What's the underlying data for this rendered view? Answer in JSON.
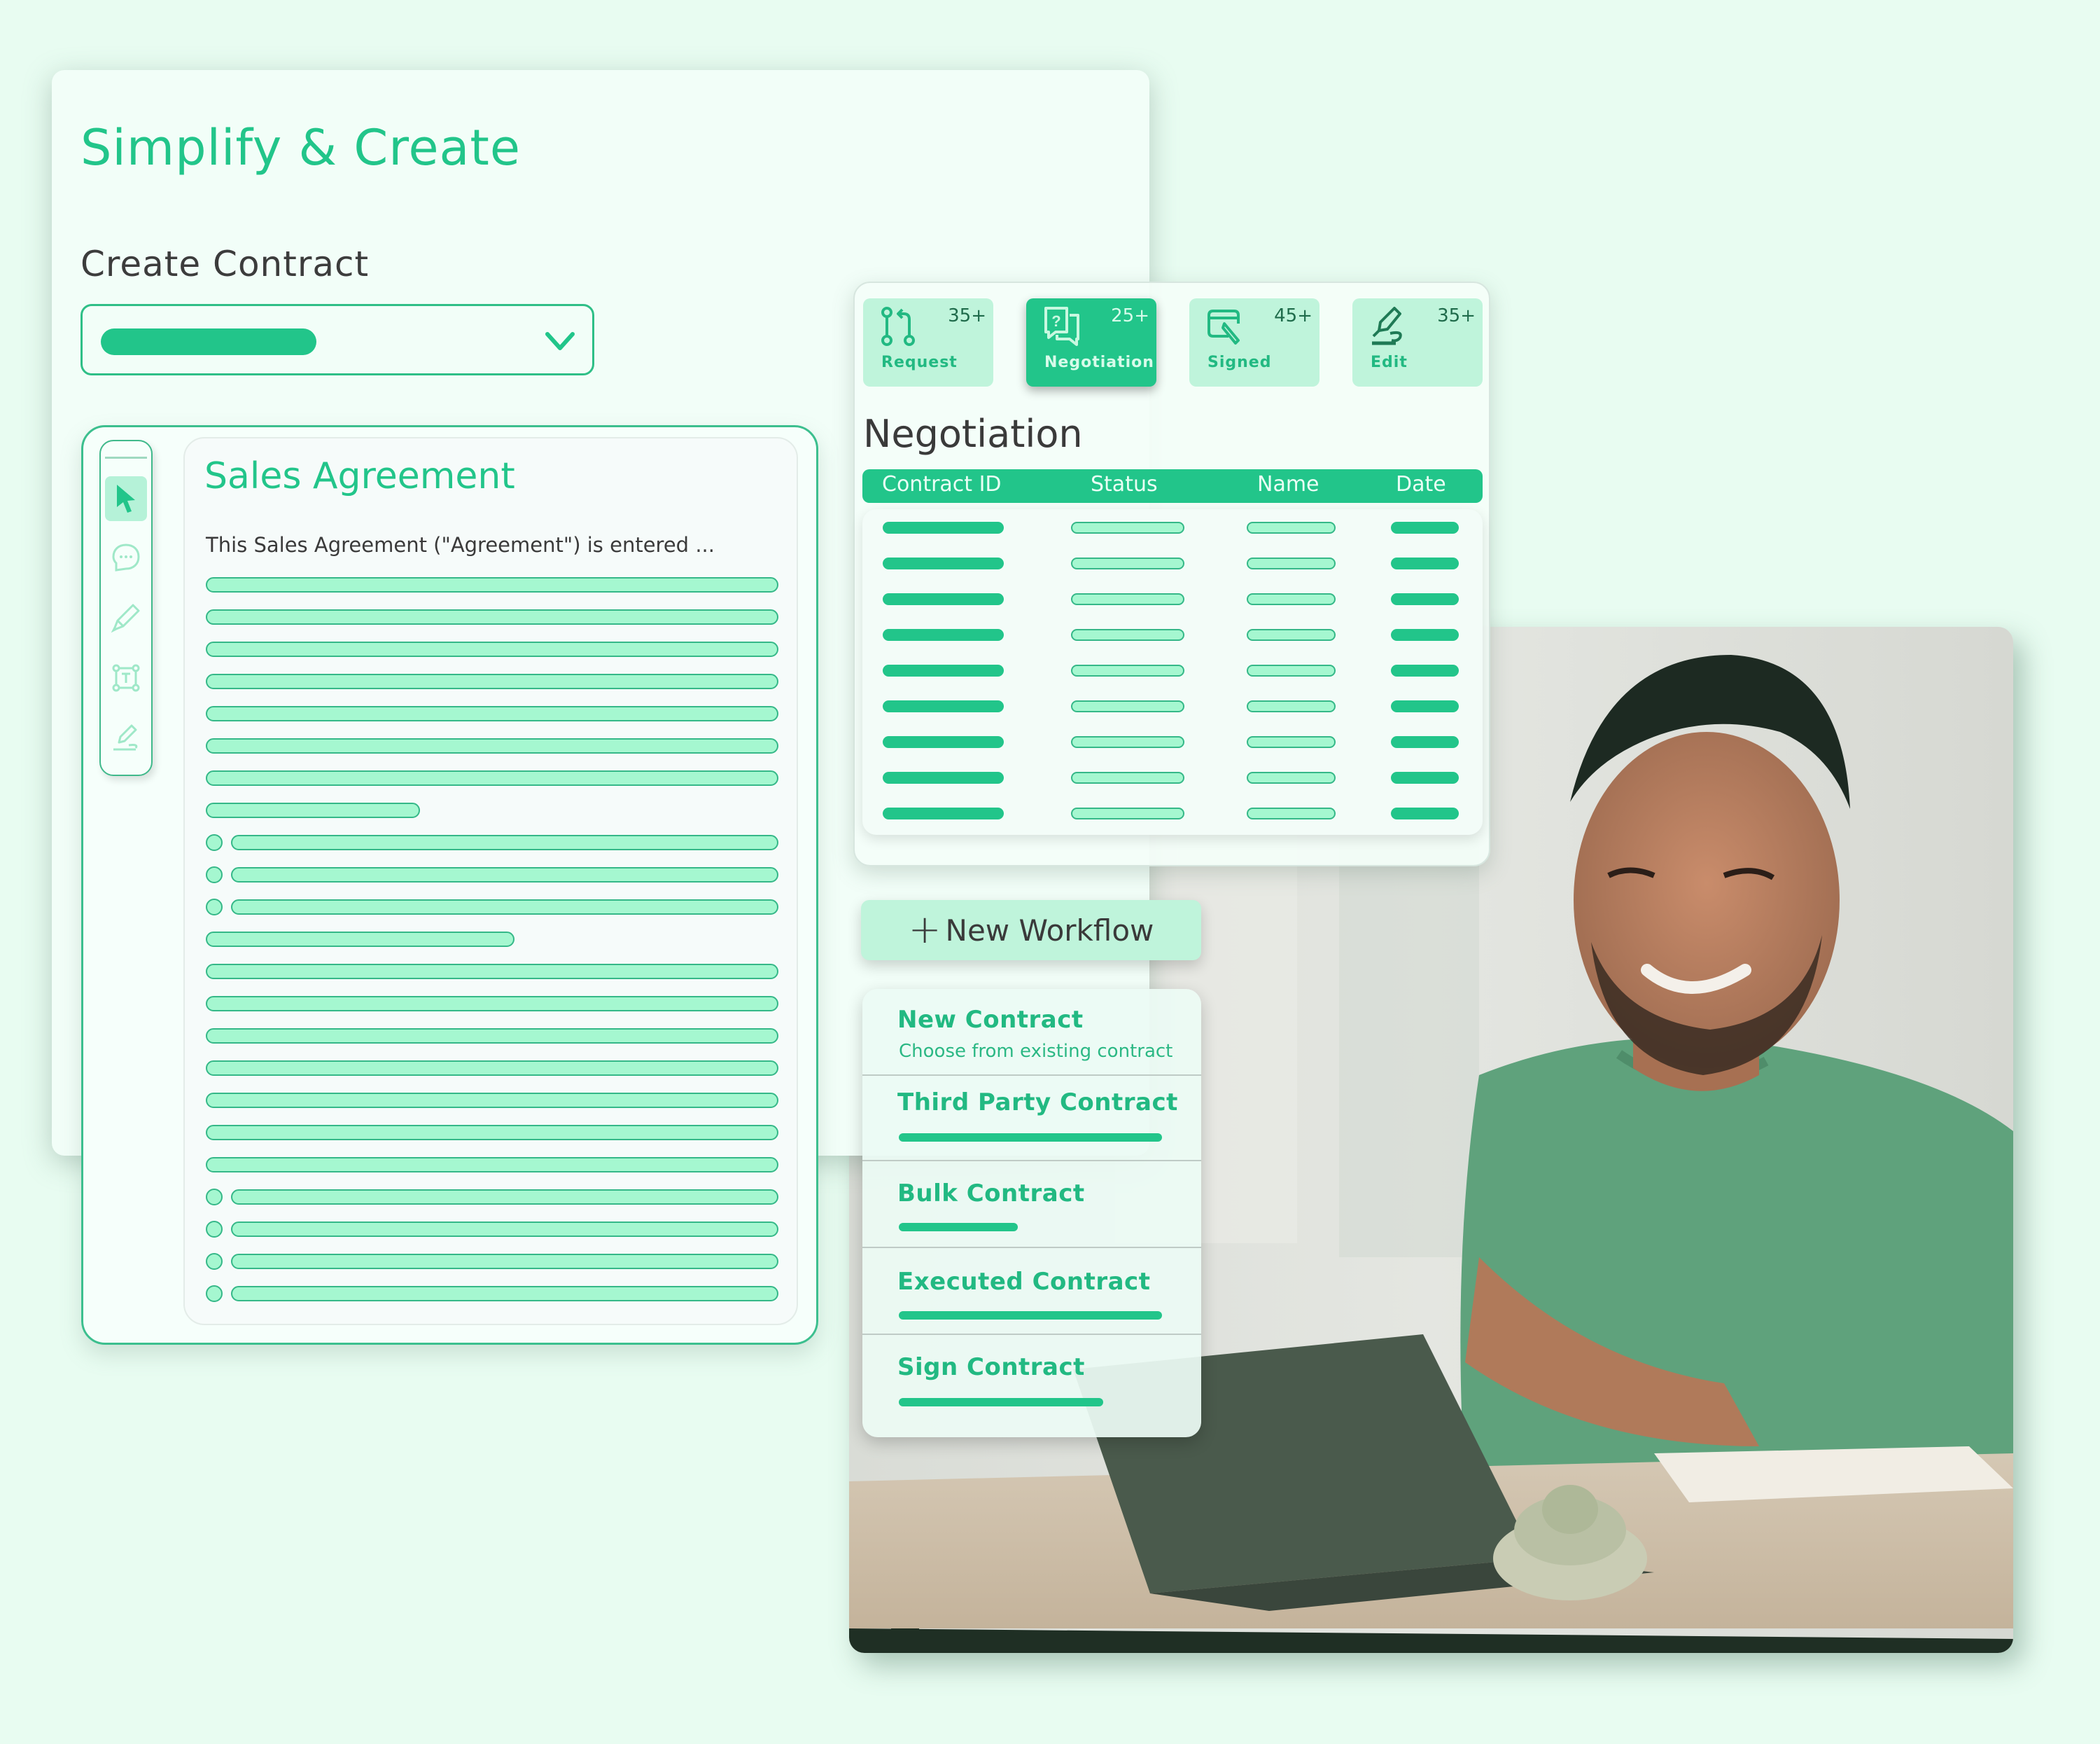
{
  "main_card": {
    "title": "Simplify & Create",
    "create_label": "Create Contract",
    "dropdown": {
      "selected_value": "",
      "icon": "chevron-down-icon"
    }
  },
  "editor": {
    "tools": [
      {
        "name": "select",
        "icon": "cursor-icon",
        "active": true
      },
      {
        "name": "comment",
        "icon": "chat-bubble-icon",
        "active": false
      },
      {
        "name": "highlight",
        "icon": "highlighter-icon",
        "active": false
      },
      {
        "name": "text",
        "icon": "text-box-icon",
        "active": false
      },
      {
        "name": "signature",
        "icon": "signature-pen-icon",
        "active": false
      }
    ],
    "document": {
      "title": "Sales Agreement",
      "intro": "This Sales Agreement (\"Agreement\") is entered ..."
    }
  },
  "status_cards": [
    {
      "label": "Request",
      "count": "35+",
      "icon": "git-pull-request-icon",
      "active": false
    },
    {
      "label": "Negotiation",
      "count": "25+",
      "icon": "chat-question-icon",
      "active": true
    },
    {
      "label": "Signed",
      "count": "45+",
      "icon": "signed-document-icon",
      "active": false
    },
    {
      "label": "Edit",
      "count": "35+",
      "icon": "fountain-pen-icon",
      "active": false
    }
  ],
  "negotiation": {
    "title": "Negotiation",
    "columns": [
      "Contract ID",
      "Status",
      "Name",
      "Date"
    ],
    "row_count": 9
  },
  "workflow": {
    "button_label": "New Workflow",
    "button_icon": "plus-icon",
    "menu": [
      {
        "title": "New Contract",
        "subtitle": "Choose from existing contract"
      },
      {
        "title": "Third Party Contract"
      },
      {
        "title": "Bulk Contract"
      },
      {
        "title": "Executed Contract"
      },
      {
        "title": "Sign Contract"
      }
    ]
  },
  "colors": {
    "accent": "#22c58a",
    "accent_light": "#a5f7d0",
    "card_light": "#bff4db",
    "page_bg": "#e8fcf1",
    "text_dark": "#3a3a3a"
  }
}
